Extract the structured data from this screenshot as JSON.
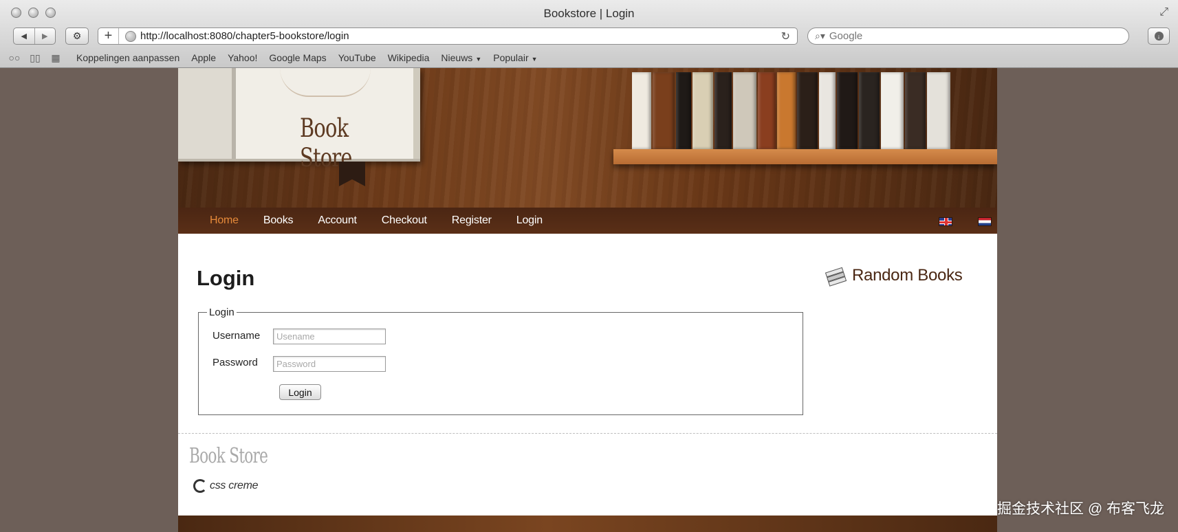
{
  "browser": {
    "window_title": "Bookstore | Login",
    "url": "http://localhost:8080/chapter5-bookstore/login",
    "search_placeholder": "Google",
    "bookmarks": [
      {
        "label": "Koppelingen aanpassen"
      },
      {
        "label": "Apple"
      },
      {
        "label": "Yahoo!"
      },
      {
        "label": "Google Maps"
      },
      {
        "label": "YouTube"
      },
      {
        "label": "Wikipedia"
      },
      {
        "label": "Nieuws",
        "dropdown": true
      },
      {
        "label": "Populair",
        "dropdown": true
      }
    ],
    "icons": [
      "back-icon",
      "forward-icon",
      "share-icon",
      "add-tab-icon",
      "globe-icon",
      "reload-icon",
      "search-icon",
      "download-icon",
      "reading-list-icon",
      "bookmarks-icon",
      "top-sites-icon",
      "fullscreen-icon"
    ]
  },
  "header": {
    "logo_text": "Book Store",
    "spine_colors": [
      "#efeae0",
      "#7a3f1c",
      "#1f1a17",
      "#d9cfb4",
      "#2a211c",
      "#cfc8ba",
      "#8a3e1f",
      "#c9782f",
      "#2b1f18",
      "#e9e6e0",
      "#201916",
      "#2a2420",
      "#f1efe9",
      "#3a2c24",
      "#e4e1da"
    ]
  },
  "nav": {
    "items": [
      {
        "label": "Home",
        "active": true
      },
      {
        "label": "Books"
      },
      {
        "label": "Account"
      },
      {
        "label": "Checkout"
      },
      {
        "label": "Register"
      },
      {
        "label": "Login"
      }
    ],
    "active_color": "#e68a3a",
    "flags": [
      "uk-flag-icon",
      "nl-flag-icon"
    ]
  },
  "main": {
    "title": "Login",
    "fieldset_legend": "Login",
    "username_label": "Username",
    "username_placeholder": "Usename",
    "password_label": "Password",
    "password_placeholder": "Password",
    "submit_label": "Login"
  },
  "sidebar": {
    "title": "Random Books"
  },
  "footer": {
    "logo_text": "Book Store",
    "credit": "css creme"
  },
  "watermark": "掘金技术社区 @ 布客飞龙"
}
